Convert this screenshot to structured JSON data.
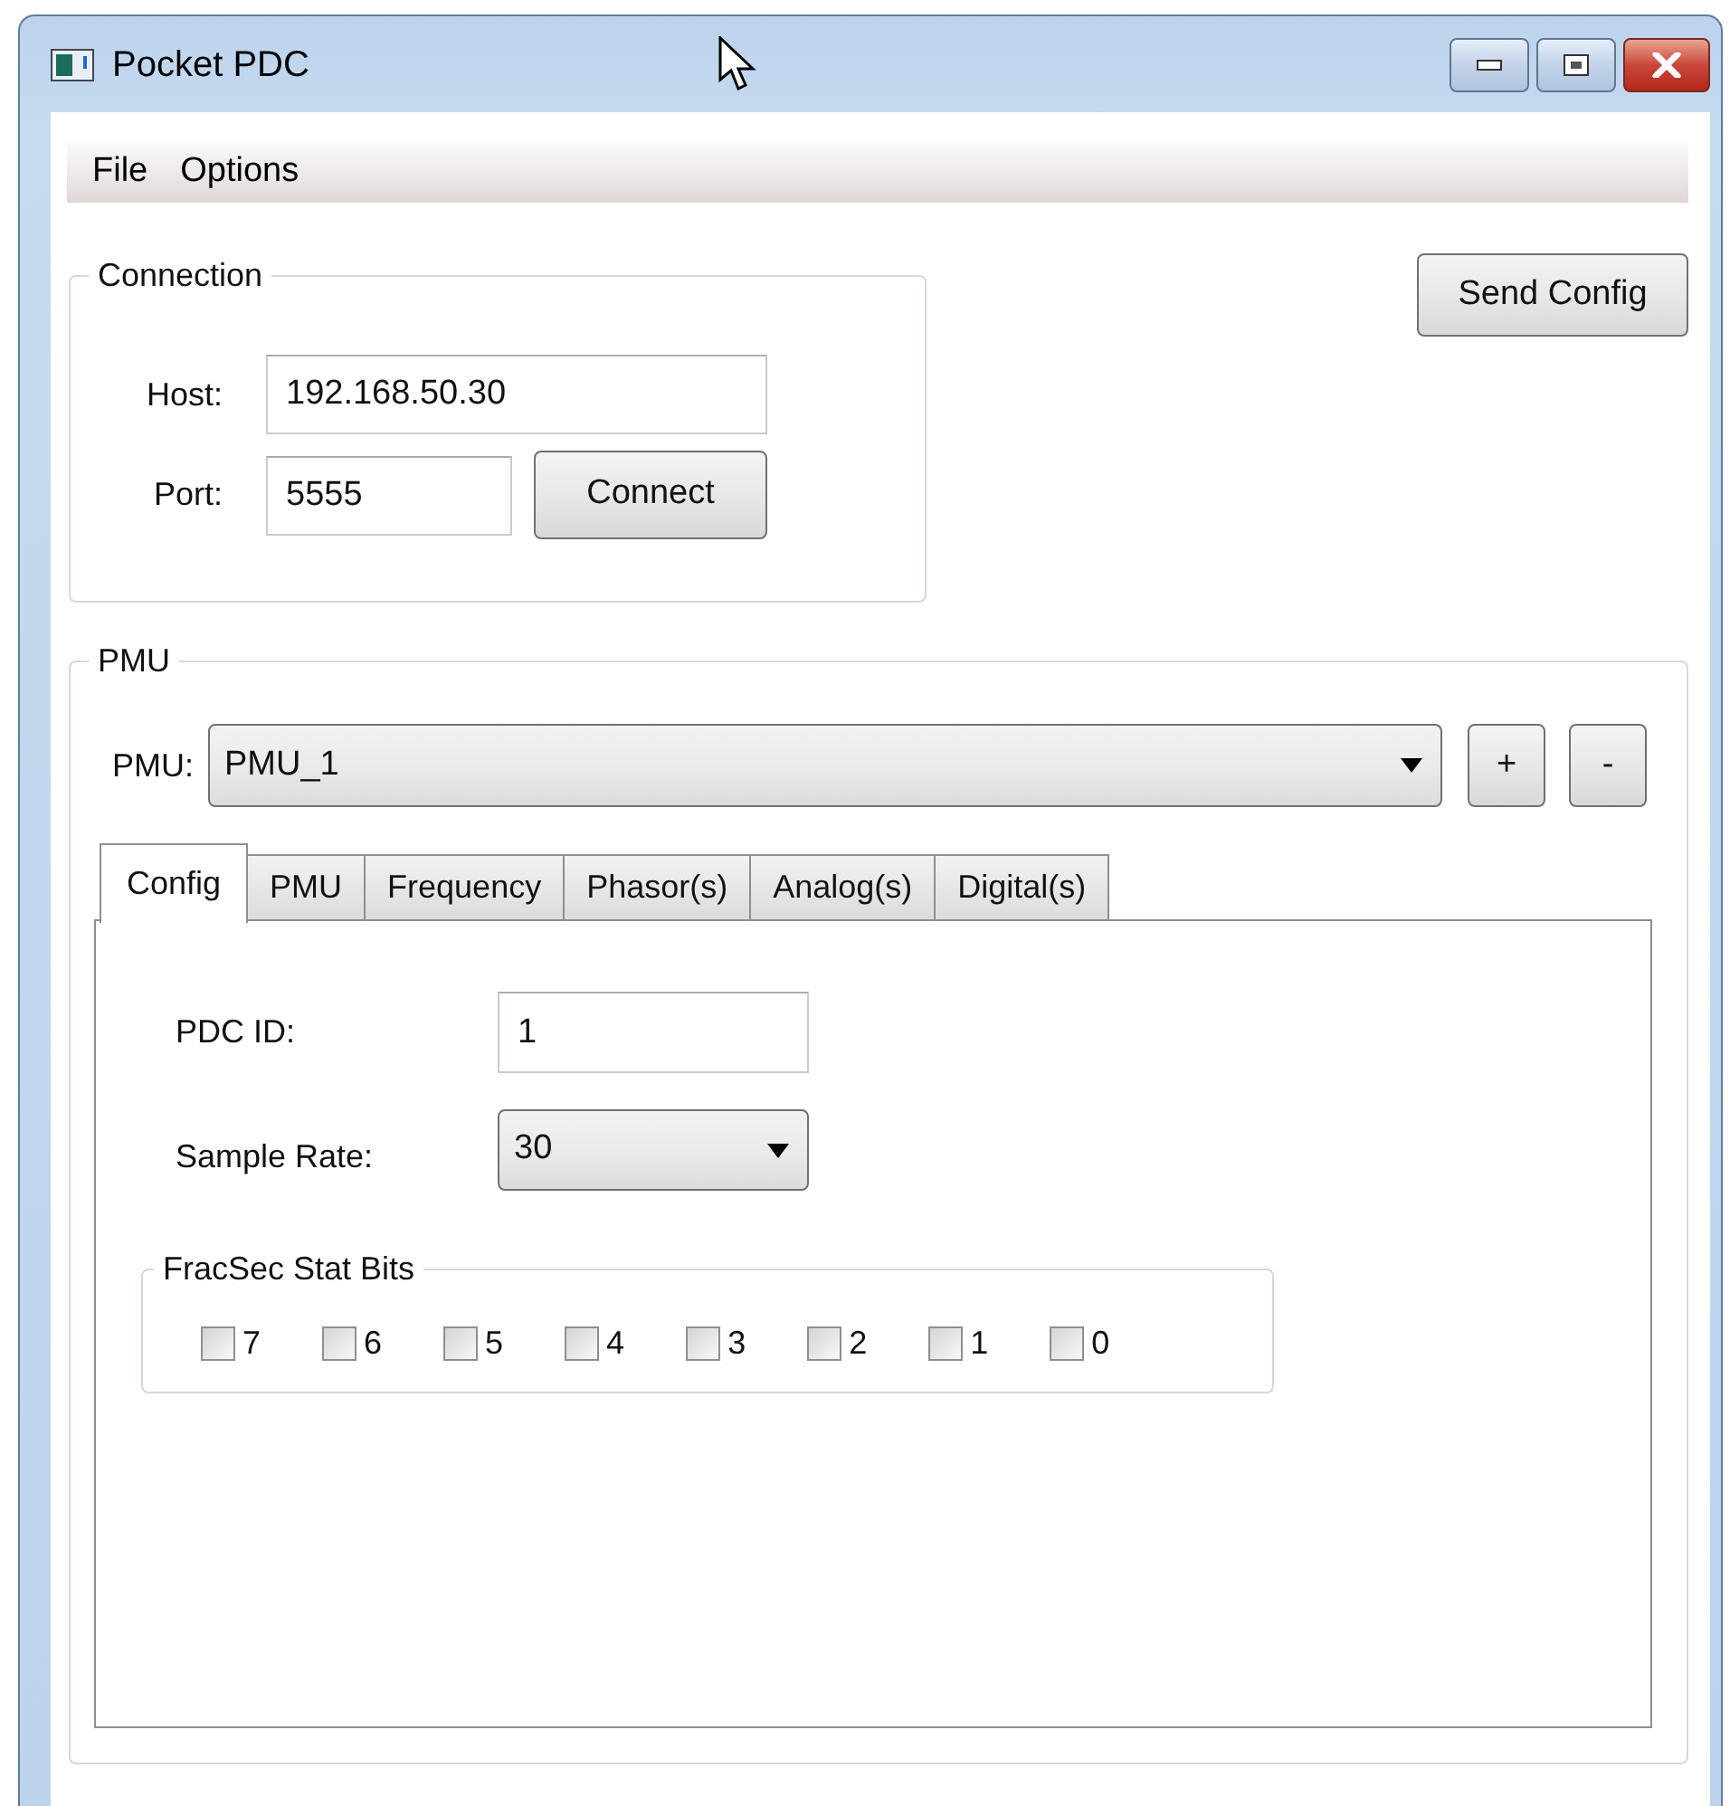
{
  "window": {
    "title": "Pocket PDC"
  },
  "menu": [
    {
      "label": "File"
    },
    {
      "label": "Options"
    }
  ],
  "connection": {
    "legend": "Connection",
    "host_label": "Host:",
    "host": "192.168.50.30",
    "port_label": "Port:",
    "port": "5555",
    "connect_button": "Connect"
  },
  "send_config_button": "Send Config",
  "pmu_group": {
    "legend": "PMU",
    "label": "PMU:",
    "selected_pmu": "PMU_1",
    "add_button": "+",
    "remove_button": "-"
  },
  "tabs": [
    {
      "label": "Config",
      "selected": true
    },
    {
      "label": "PMU",
      "selected": false
    },
    {
      "label": "Frequency",
      "selected": false
    },
    {
      "label": "Phasor(s)",
      "selected": false
    },
    {
      "label": "Analog(s)",
      "selected": false
    },
    {
      "label": "Digital(s)",
      "selected": false
    }
  ],
  "config": {
    "pdc_id_label": "PDC ID:",
    "pdc_id": "1",
    "sample_rate_label": "Sample Rate:",
    "sample_rate": "30",
    "stat_bits": {
      "legend": "FracSec Stat Bits",
      "bits": [
        {
          "label": "7",
          "checked": false
        },
        {
          "label": "6",
          "checked": false
        },
        {
          "label": "5",
          "checked": false
        },
        {
          "label": "4",
          "checked": false
        },
        {
          "label": "3",
          "checked": false
        },
        {
          "label": "2",
          "checked": false
        },
        {
          "label": "1",
          "checked": false
        },
        {
          "label": "0",
          "checked": false
        }
      ]
    }
  }
}
